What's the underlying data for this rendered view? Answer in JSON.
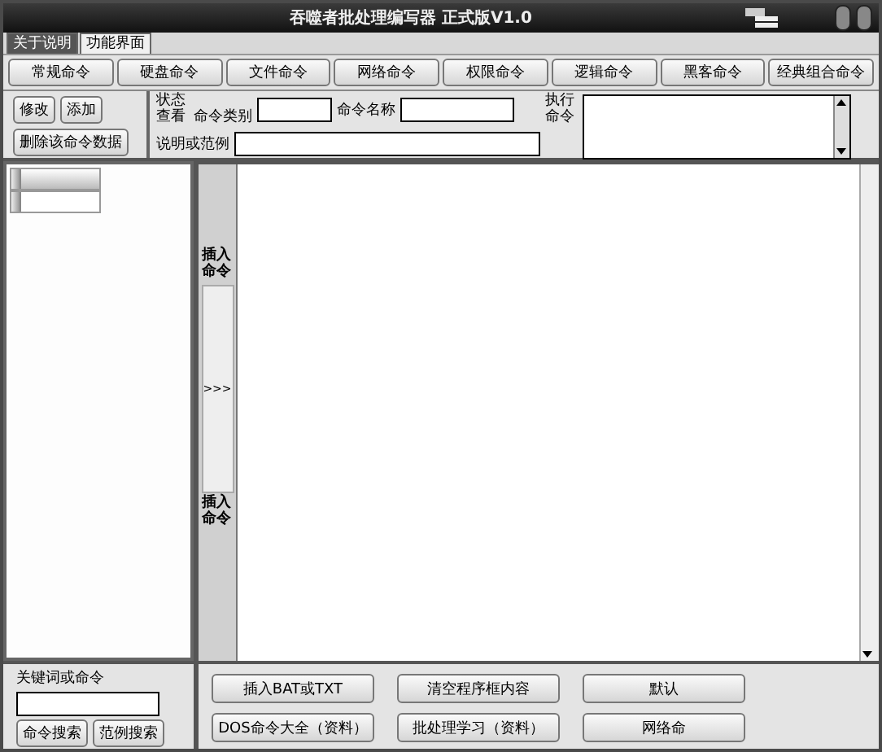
{
  "window": {
    "title": "吞噬者批处理编写器 正式版V1.0"
  },
  "tabs": [
    {
      "label": "关于说明",
      "selected": false
    },
    {
      "label": "功能界面",
      "selected": true
    }
  ],
  "command_categories": [
    "常规命令",
    "硬盘命令",
    "文件命令",
    "网络命令",
    "权限命令",
    "逻辑命令",
    "黑客命令",
    "经典组合命令"
  ],
  "editor": {
    "buttons": [
      "修改",
      "添加",
      "删除该命令数据"
    ],
    "status_label": "状态查看",
    "category_label": "命令类别",
    "name_label": "命令名称",
    "execute_label": "执行命令",
    "description_label": "说明或范例"
  },
  "insert_strip": {
    "top_label": "插入命令",
    "arrow_button": ">>>",
    "bottom_label": "插入命令"
  },
  "search": {
    "label": "关键词或命令",
    "buttons": [
      "命令搜索",
      "范例搜索"
    ]
  },
  "actions": [
    "插入BAT或TXT",
    "清空程序框内容",
    "默认",
    "DOS命令大全（资料）",
    "批处理学习（资料）",
    "网络命"
  ]
}
